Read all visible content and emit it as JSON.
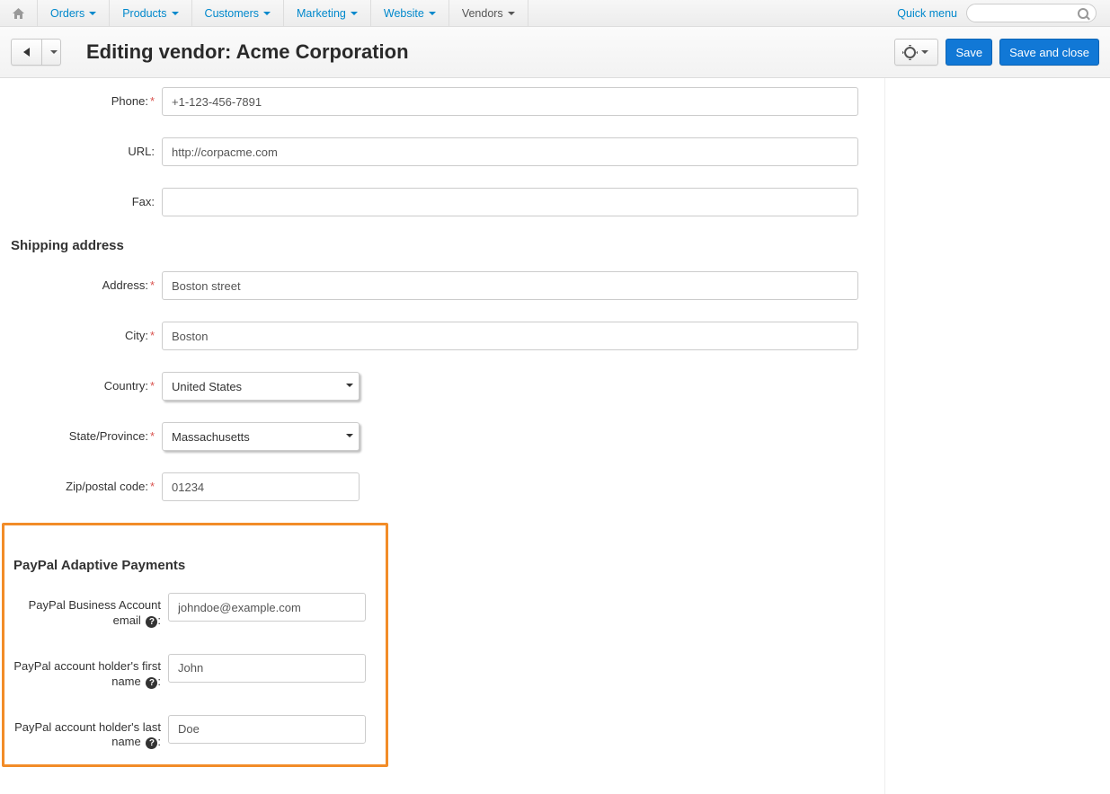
{
  "nav": {
    "items": [
      "Orders",
      "Products",
      "Customers",
      "Marketing",
      "Website",
      "Vendors"
    ],
    "active_index": 5,
    "quick_menu": "Quick menu"
  },
  "header": {
    "title": "Editing vendor: Acme Corporation",
    "save": "Save",
    "save_close": "Save and close"
  },
  "form": {
    "phone_label": "Phone:",
    "phone": "+1-123-456-7891",
    "url_label": "URL:",
    "url": "http://corpacme.com",
    "fax_label": "Fax:",
    "fax": ""
  },
  "shipping": {
    "heading": "Shipping address",
    "address_label": "Address:",
    "address": "Boston street",
    "city_label": "City:",
    "city": "Boston",
    "country_label": "Country:",
    "country": "United States",
    "state_label": "State/Province:",
    "state": "Massachusetts",
    "zip_label": "Zip/postal code:",
    "zip": "01234"
  },
  "paypal": {
    "heading": "PayPal Adaptive Payments",
    "email_label": "PayPal Business Account email",
    "email": "johndoe@example.com",
    "first_label": "PayPal account holder's first name",
    "first": "John",
    "last_label": "PayPal account holder's last name",
    "last": "Doe"
  }
}
